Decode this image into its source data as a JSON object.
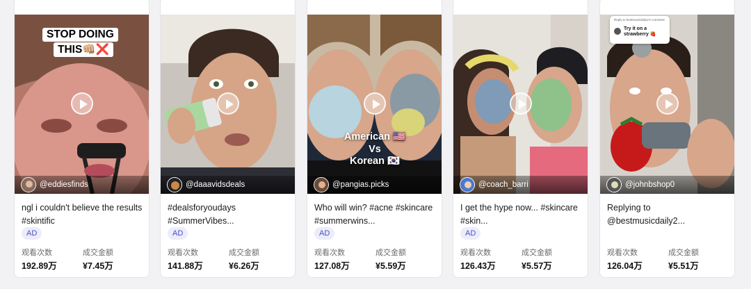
{
  "cards": [
    {
      "creator": "@eddiesfinds",
      "caption": "ngl i couldn't believe the results #skintific",
      "ad_label": "AD",
      "views_label": "观看次数",
      "views": "192.89万",
      "gmv_label": "成交金额",
      "gmv": "¥7.45万",
      "overlay": {
        "line1": "STOP DOING",
        "line2": "THIS👊🏼❌"
      }
    },
    {
      "creator": "@daaavidsdeals",
      "caption": "#dealsforyoudays #SummerVibes...",
      "ad_label": "AD",
      "views_label": "观看次数",
      "views": "141.88万",
      "gmv_label": "成交金额",
      "gmv": "¥6.26万"
    },
    {
      "creator": "@pangias.picks",
      "caption": "Who will win? #acne #skincare #summerwins...",
      "ad_label": "AD",
      "views_label": "观看次数",
      "views": "127.08万",
      "gmv_label": "成交金额",
      "gmv": "¥5.59万",
      "overlay": {
        "line1": "American 🇺🇸",
        "line2": "Vs",
        "line3": "Korean 🇰🇷"
      }
    },
    {
      "creator": "@coach_barri",
      "caption": "I get the hype now... #skincare #skin...",
      "ad_label": "AD",
      "views_label": "观看次数",
      "views": "126.43万",
      "gmv_label": "成交金额",
      "gmv": "¥5.57万"
    },
    {
      "creator": "@johnbshop0",
      "caption": "Replying to @bestmusicdaily2...",
      "views_label": "观看次数",
      "views": "126.04万",
      "gmv_label": "成交金额",
      "gmv": "¥5.51万",
      "reply": {
        "header": "Reply to bestmusicdaily2's comment",
        "text": "Try it on a strawberry 🍓"
      }
    }
  ],
  "icons": {
    "play": "play-icon",
    "avatar": "avatar"
  },
  "colors": {
    "ad_badge_bg": "#ececfa",
    "ad_badge_text": "#4a4fc5"
  }
}
